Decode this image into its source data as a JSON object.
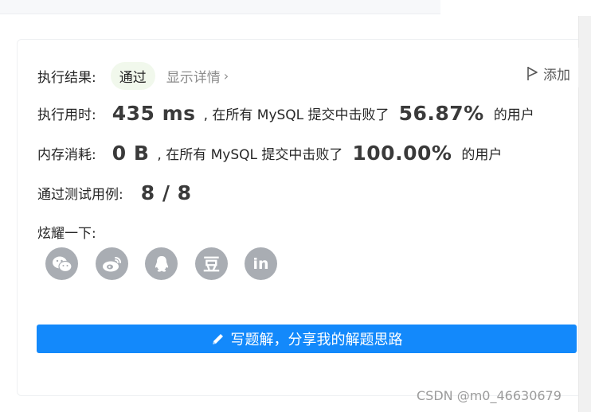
{
  "result": {
    "label": "执行结果:",
    "status": "通过",
    "detail_link": "显示详情",
    "detail_chevron": "›",
    "add_note": "添加"
  },
  "runtime": {
    "label": "执行用时:",
    "value": "435 ms",
    "mid_text": ", 在所有 MySQL 提交中击败了",
    "percent": "56.87%",
    "suffix": "的用户"
  },
  "memory": {
    "label": "内存消耗:",
    "value": "0 B",
    "mid_text": ", 在所有 MySQL 提交中击败了",
    "percent": "100.00%",
    "suffix": "的用户"
  },
  "tests": {
    "label": "通过测试用例:",
    "value": "8 / 8"
  },
  "share": {
    "label": "炫耀一下:",
    "icons": [
      "wechat-icon",
      "weibo-icon",
      "qq-icon",
      "douban-icon",
      "linkedin-icon"
    ],
    "douban_glyph": "豆",
    "linkedin_glyph": "in"
  },
  "write_button": {
    "label": "写题解，分享我的解题思路"
  },
  "watermark": "CSDN @m0_46630679",
  "colors": {
    "primary": "#1389fb",
    "pass_bg": "#f1f8ec",
    "icon_gray": "#a9adb3"
  }
}
